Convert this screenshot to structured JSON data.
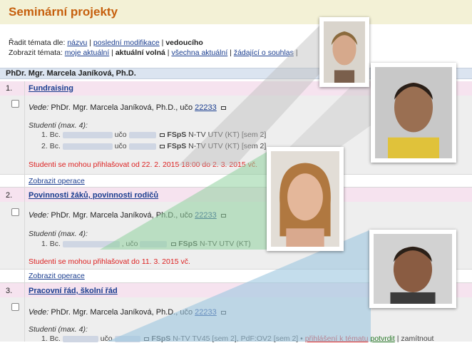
{
  "page_title": "Seminární projekty",
  "sort_line": {
    "prefix": "Řadit témata dle:",
    "name": "názvu",
    "sep1": "|",
    "modified": "poslední modifikace",
    "sep2": "|",
    "supervisor": "vedoucího"
  },
  "show_line": {
    "prefix": "Zobrazit témata:",
    "mine": "moje aktuální",
    "sep1": "|",
    "free": "aktuální volná",
    "sep2": "|",
    "all": "všechna aktuální",
    "sep3": "|",
    "requests": "žádající o souhlas",
    "sep4": "|"
  },
  "supervisor_name": "PhDr. Mgr. Marcela Janíková, Ph.D.",
  "projects": [
    {
      "num": "1.",
      "title": "Fundraising",
      "vede_label": "Vede:",
      "vede_name": "PhDr. Mgr. Marcela Janíková, Ph.D., učo",
      "uco": "22233",
      "students_label": "Studenti (max. 4):",
      "students": [
        {
          "num": "1.",
          "prefix": "Bc.",
          "uco_label": "učo",
          "faculty": "FSpS",
          "program": "N-TV UTV (KT) [sem 2]"
        },
        {
          "num": "2.",
          "prefix": "Bc.",
          "uco_label": "učo",
          "faculty": "FSpS",
          "program": "N-TV UTV (KT) [sem 2]"
        }
      ],
      "note": "Studenti se mohou přihlašovat od 22. 2. 2015 18:00 do 2. 3. 2015 vč.",
      "ops": "Zobrazit operace"
    },
    {
      "num": "2.",
      "title": "Povinnosti žáků, povinnosti rodičů",
      "vede_label": "Vede:",
      "vede_name": "PhDr. Mgr. Marcela Janíková, Ph.D., učo",
      "uco": "22233",
      "students_label": "Studenti (max. 4):",
      "students": [
        {
          "num": "1.",
          "prefix": "Bc.",
          "uco_label": ", učo",
          "faculty": "FSpS",
          "program": "N-TV UTV (KT)"
        }
      ],
      "note": "Studenti se mohou přihlašovat do 11. 3. 2015 vč.",
      "ops": "Zobrazit operace"
    },
    {
      "num": "3.",
      "title": "Pracovní řád, školní řád",
      "vede_label": "Vede:",
      "vede_name": "PhDr. Mgr. Marcela Janíková, Ph.D., učo",
      "uco": "22233",
      "students_label": "Studenti (max. 4):",
      "students": [
        {
          "num": "1.",
          "prefix": "Bc.",
          "uco_label": "učo",
          "faculty": "FSpS",
          "program": "N-TV TV45 [sem 2], PdF:OV2 [sem 2] •",
          "action1": "přihlášení k tématu",
          "action2": "potvrdit",
          "action3": "| zamítnout"
        }
      ]
    }
  ],
  "colors": {
    "title": "#c65f0d",
    "link": "#1a3d8f",
    "note": "#dd2222",
    "supervisor_bar": "#dbe4f0",
    "overlay_gray": "#bcbcbc",
    "overlay_green": "#8fd19e",
    "overlay_blue": "#9cc6e0"
  },
  "icons": [
    "mail-icon",
    "checkbox-icon",
    "student-photo"
  ]
}
